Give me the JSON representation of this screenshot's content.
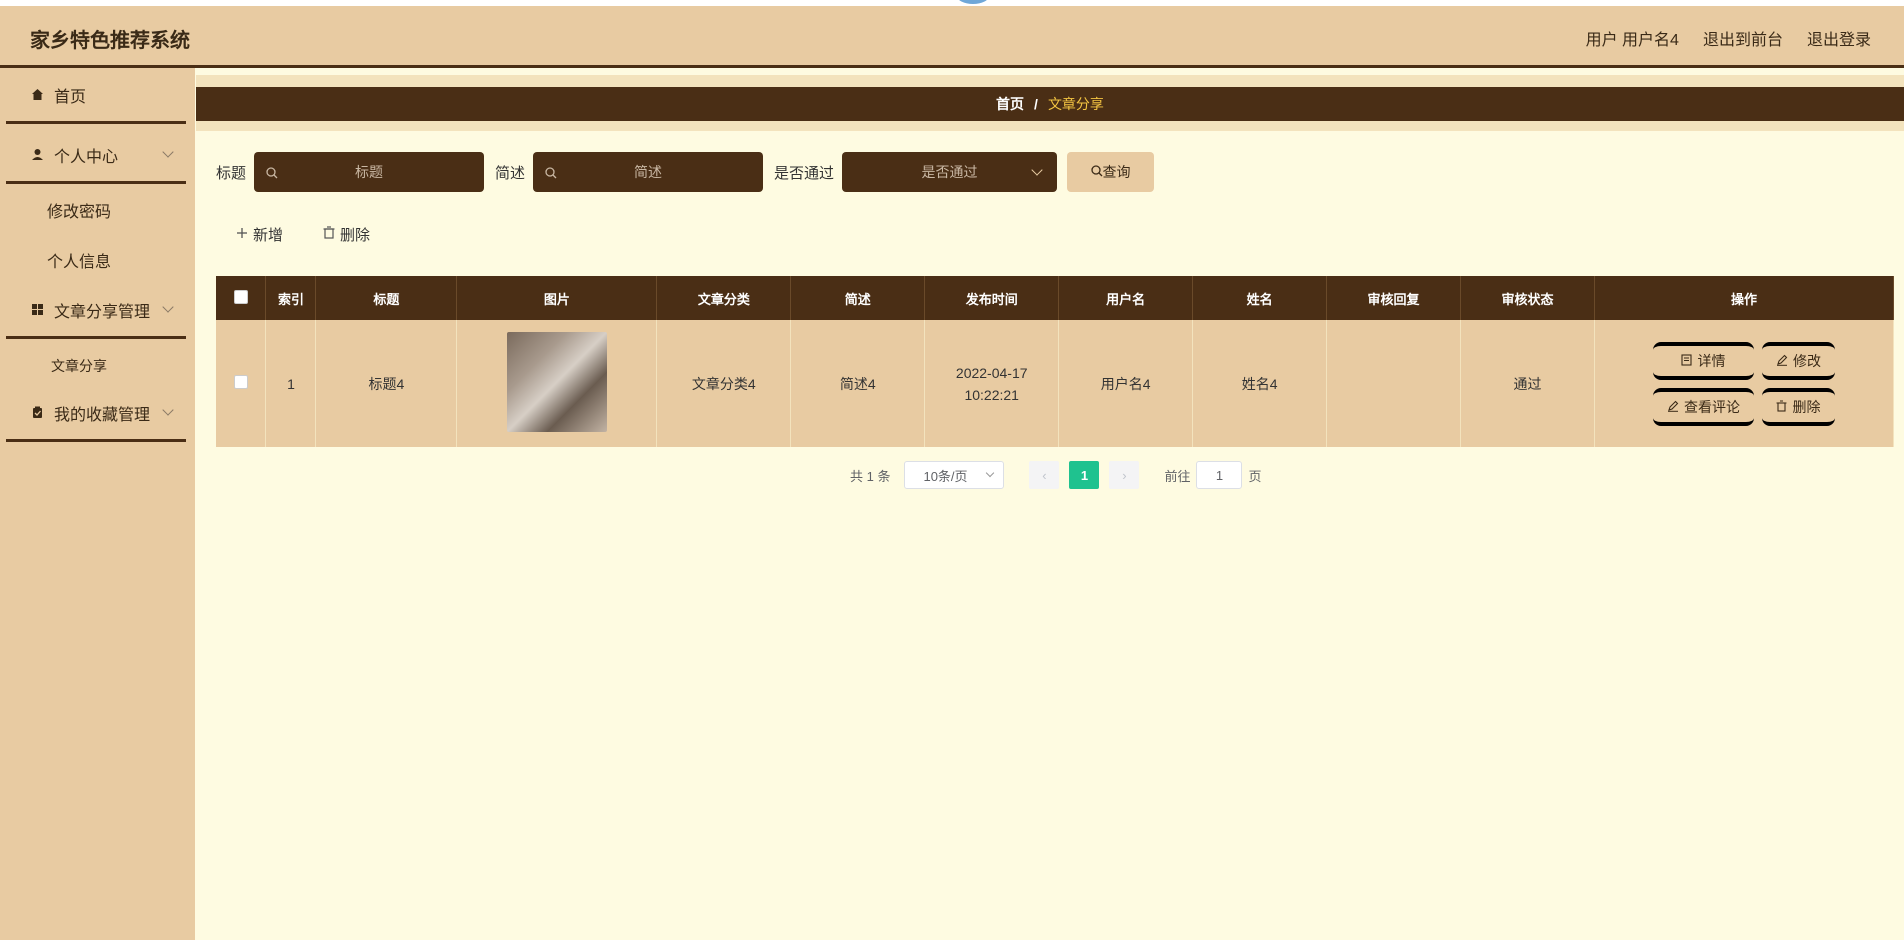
{
  "header": {
    "title": "家乡特色推荐系统",
    "user_label": "用户 用户名4",
    "back_front": "退出到前台",
    "logout": "退出登录"
  },
  "sidebar": {
    "home": "首页",
    "personal_center": "个人中心",
    "change_password": "修改密码",
    "personal_info": "个人信息",
    "article_mgmt": "文章分享管理",
    "article_share": "文章分享",
    "favorites_mgmt": "我的收藏管理"
  },
  "breadcrumb": {
    "home": "首页",
    "separator": "/",
    "current": "文章分享"
  },
  "search": {
    "title_label": "标题",
    "title_placeholder": "标题",
    "desc_label": "简述",
    "desc_placeholder": "简述",
    "pass_label": "是否通过",
    "pass_placeholder": "是否通过",
    "query_button": "查询"
  },
  "actions": {
    "add": "新增",
    "delete": "删除"
  },
  "table": {
    "headers": [
      "索引",
      "标题",
      "图片",
      "文章分类",
      "简述",
      "发布时间",
      "用户名",
      "姓名",
      "审核回复",
      "审核状态",
      "操作"
    ],
    "rows": [
      {
        "index": "1",
        "title": "标题4",
        "category": "文章分类4",
        "desc": "简述4",
        "time": "2022-04-17 10:22:21",
        "username": "用户名4",
        "name": "姓名4",
        "reply": "",
        "status": "通过"
      }
    ],
    "ops": {
      "detail": "详情",
      "edit": "修改",
      "comments": "查看评论",
      "delete": "删除"
    }
  },
  "pagination": {
    "total": "共 1 条",
    "page_size": "10条/页",
    "current_page": "1",
    "goto_label": "前往",
    "goto_value": "1",
    "page_suffix": "页"
  }
}
